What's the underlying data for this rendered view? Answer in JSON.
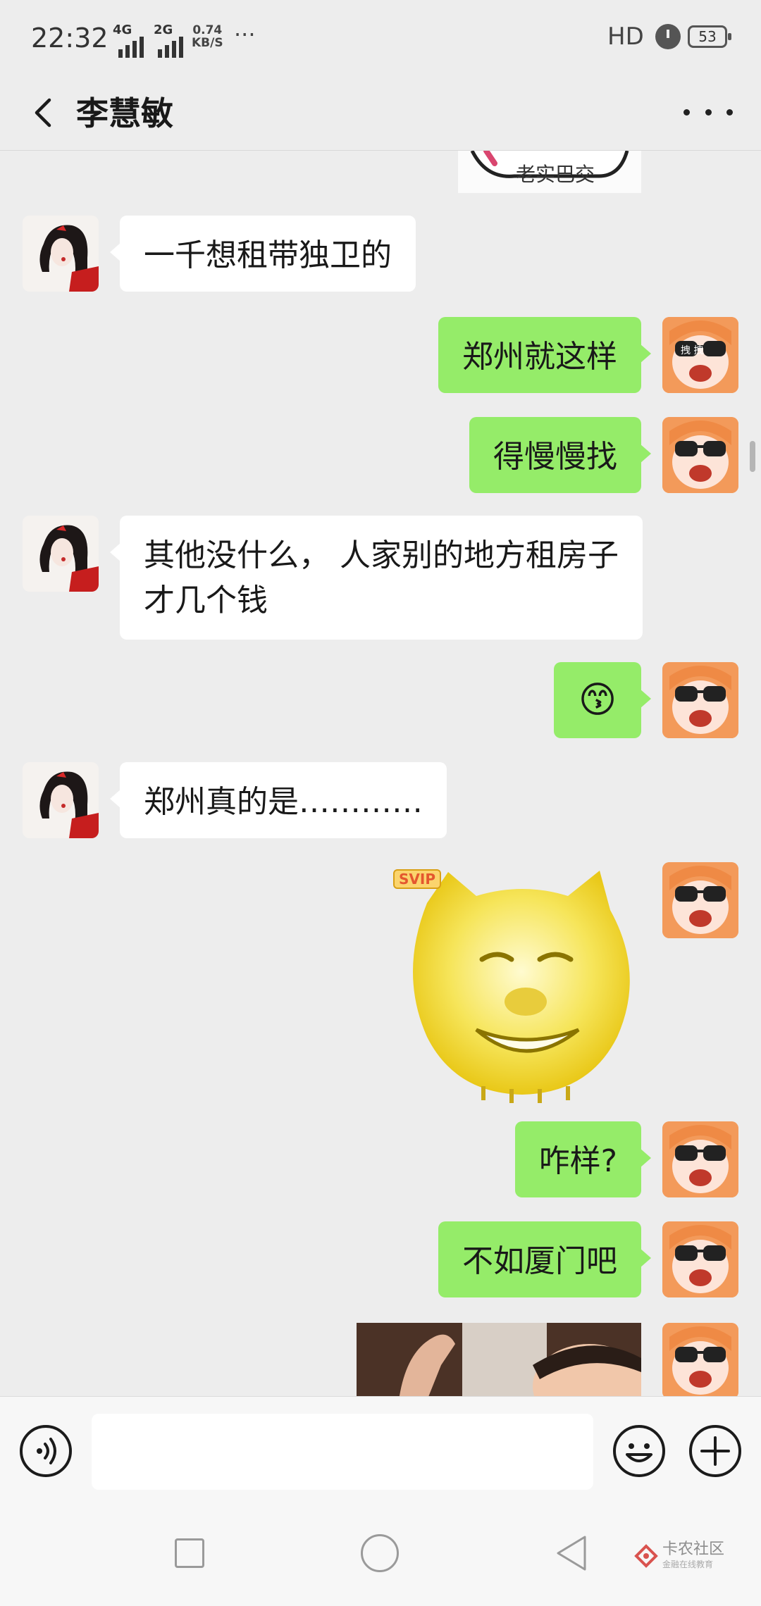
{
  "status_bar": {
    "time": "22:32",
    "network_1": "4G",
    "network_2": "2G",
    "speed_value": "0.74",
    "speed_unit": "KB/S",
    "more": "···",
    "hd": "HD",
    "battery": "53"
  },
  "header": {
    "title": "李慧敏"
  },
  "messages": [
    {
      "side": "left",
      "type": "text",
      "text": "一千想租带独卫的"
    },
    {
      "side": "right",
      "type": "text",
      "text": "郑州就这样"
    },
    {
      "side": "right",
      "type": "text",
      "text": "得慢慢找"
    },
    {
      "side": "left",
      "type": "text",
      "text": "其他没什么， 人家别的地方租房子才几个钱"
    },
    {
      "side": "right",
      "type": "emoji",
      "text": "😙"
    },
    {
      "side": "left",
      "type": "text",
      "text": "郑州真的是…………"
    },
    {
      "side": "right",
      "type": "sticker",
      "badge": "SVIP"
    },
    {
      "side": "right",
      "type": "text",
      "text": "咋样?"
    },
    {
      "side": "right",
      "type": "text",
      "text": "不如厦门吧"
    },
    {
      "side": "right",
      "type": "image"
    }
  ],
  "top_sticker_caption": "老实巴交",
  "avatar_caption": "拽 拽",
  "watermark": {
    "title": "卡农社区",
    "subtitle": "金融在线教育"
  },
  "colors": {
    "background": "#ededed",
    "bubble_self": "#95ec69",
    "bubble_other": "#ffffff"
  }
}
